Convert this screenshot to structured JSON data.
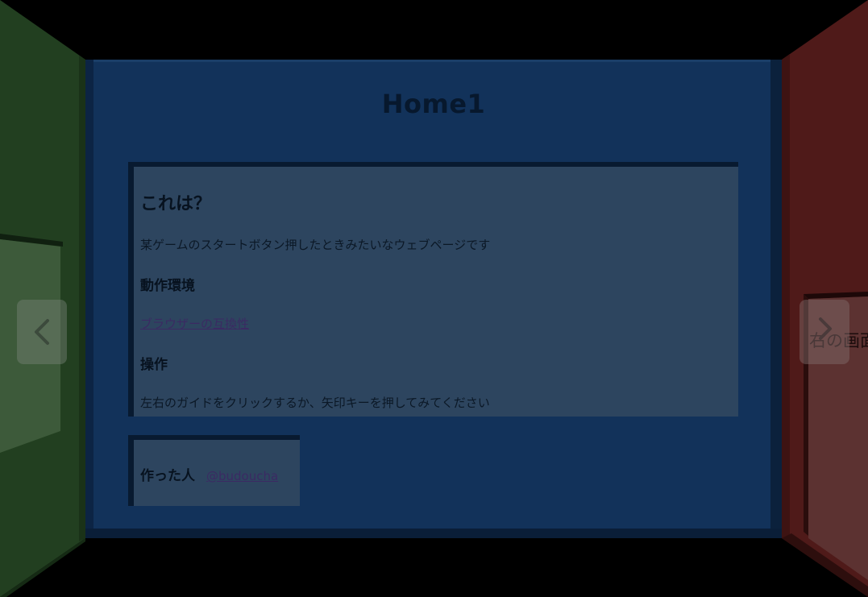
{
  "page": {
    "title": "Home1"
  },
  "info_card": {
    "heading": "これは？",
    "description": "某ゲームのスタートボタン押したときみたいなウェブページです",
    "env_heading": "動作環境",
    "env_link": "ブラウザーの互換性",
    "ops_heading": "操作",
    "ops_text": "左右のガイドをクリックするか、矢印キーを押してみてください"
  },
  "author_card": {
    "label": "作った人",
    "link": "@budoucha"
  },
  "right_panel": {
    "peek_text": "右の画面で"
  },
  "nav": {
    "prev_icon": "chevron-left-icon",
    "next_icon": "chevron-right-icon"
  },
  "colors": {
    "front_wall": "#12325a",
    "left_wall": "#223f20",
    "right_wall": "#4f1a19",
    "card": "#2d455f",
    "link": "#3b2a63"
  }
}
